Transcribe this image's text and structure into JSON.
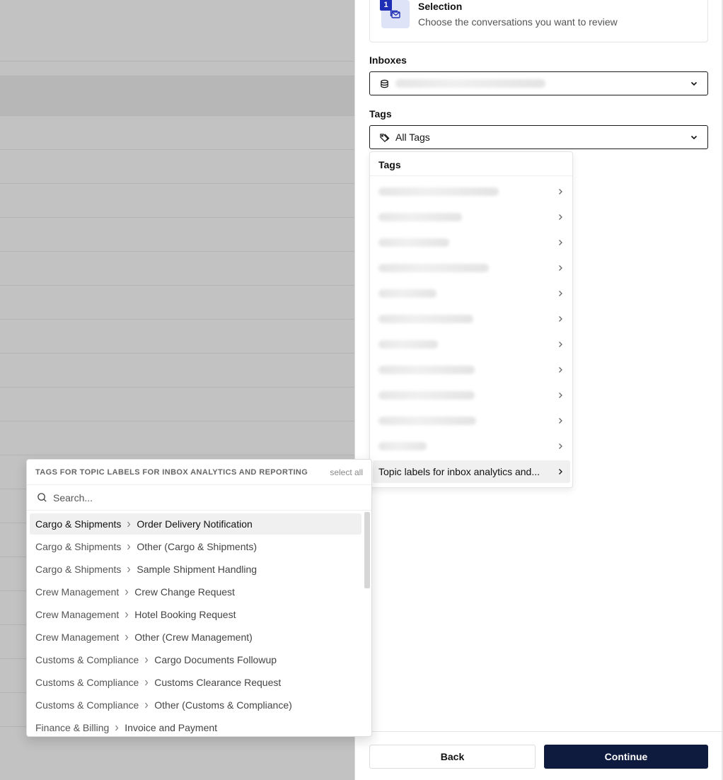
{
  "step": {
    "number": "1",
    "title": "Selection",
    "description": "Choose the conversations you want to review"
  },
  "inboxes": {
    "label": "Inboxes"
  },
  "tags": {
    "label": "Tags",
    "selected": "All Tags",
    "menu_title": "Tags",
    "active_item": "Topic labels for inbox analytics and..."
  },
  "submenu": {
    "title": "TAGS FOR TOPIC LABELS FOR INBOX ANALYTICS AND REPORTING",
    "select_all": "select all",
    "search_placeholder": "Search...",
    "options": [
      {
        "category": "Cargo & Shipments",
        "label": "Order Delivery Notification"
      },
      {
        "category": "Cargo & Shipments",
        "label": "Other (Cargo & Shipments)"
      },
      {
        "category": "Cargo & Shipments",
        "label": "Sample Shipment Handling"
      },
      {
        "category": "Crew Management",
        "label": "Crew Change Request"
      },
      {
        "category": "Crew Management",
        "label": "Hotel Booking Request"
      },
      {
        "category": "Crew Management",
        "label": "Other (Crew Management)"
      },
      {
        "category": "Customs & Compliance",
        "label": "Cargo Documents Followup"
      },
      {
        "category": "Customs & Compliance",
        "label": "Customs Clearance Request"
      },
      {
        "category": "Customs & Compliance",
        "label": "Other (Customs & Compliance)"
      },
      {
        "category": "Finance & Billing",
        "label": "Invoice and Payment"
      }
    ]
  },
  "footer": {
    "back_label": "Back",
    "continue_label": "Continue"
  },
  "colors": {
    "primary": "#0e1a3e",
    "step_badge": "#1f2fb5",
    "step_icon_bg": "#dfe3f7"
  },
  "icons": {
    "step": "mail-stack-icon",
    "inbox": "database-icon",
    "tags": "tags-icon",
    "search": "search-icon",
    "chevron": "chevron-down-icon",
    "arrow": "chevron-right-icon"
  }
}
